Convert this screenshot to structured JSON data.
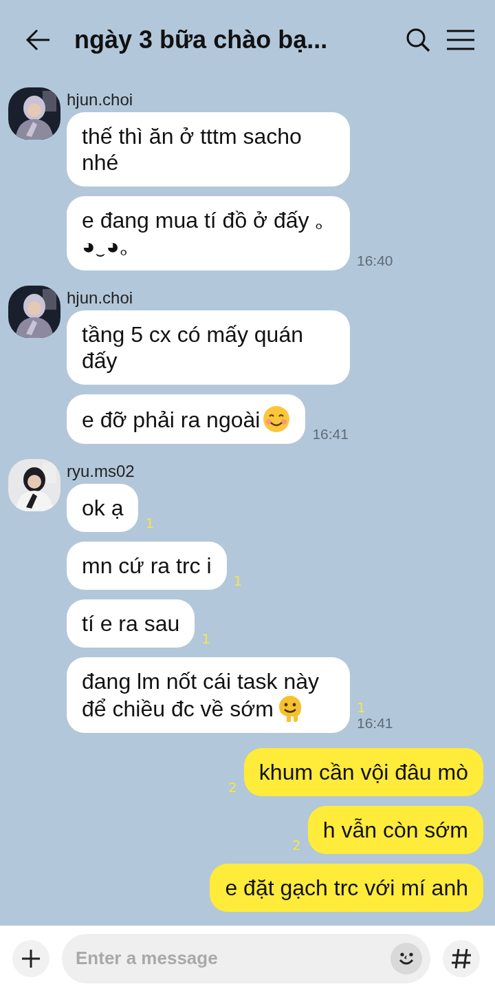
{
  "header": {
    "title": "ngày 3 bữa chào bạ..."
  },
  "groups": [
    {
      "mine": false,
      "sender": "hjun.choi",
      "avatar": {
        "kind": "picture"
      },
      "messages": [
        {
          "text": "thế thì ăn ở tttm sacho nhé",
          "kind": "plain"
        },
        {
          "text": "e đang mua tí đồ ở đấy ｡◕‿◕｡",
          "kind": "plain",
          "time": "16:40"
        }
      ]
    },
    {
      "mine": false,
      "sender": "hjun.choi",
      "avatar": {
        "kind": "picture"
      },
      "messages": [
        {
          "text": "tầng 5 cx có mấy quán đấy",
          "kind": "plain"
        },
        {
          "text": "e đỡ phải ra ngoài",
          "kind": "smile",
          "time": "16:41"
        }
      ]
    },
    {
      "mine": false,
      "sender": "ryu.ms02",
      "avatar": {
        "kind": "picture"
      },
      "messages": [
        {
          "text": "ok ạ",
          "kind": "plain",
          "unread": "1"
        },
        {
          "text": "mn cứ ra trc i",
          "kind": "plain",
          "unread": "1"
        },
        {
          "text": "tí e ra sau",
          "kind": "plain",
          "unread": "1"
        },
        {
          "text": "đang lm nốt cái task này để chiều đc về sớm",
          "kind": "melt",
          "unread": "1",
          "time": "16:41"
        }
      ]
    },
    {
      "mine": true,
      "messages": [
        {
          "text": "khum cần vội đâu mò",
          "kind": "plain",
          "unread": "2"
        },
        {
          "text": "h vẫn còn sớm",
          "kind": "plain",
          "unread": "2"
        },
        {
          "text": "e đặt gạch trc với mí anh",
          "kind": "plain"
        }
      ]
    }
  ],
  "composer": {
    "placeholder": "Enter a message"
  }
}
